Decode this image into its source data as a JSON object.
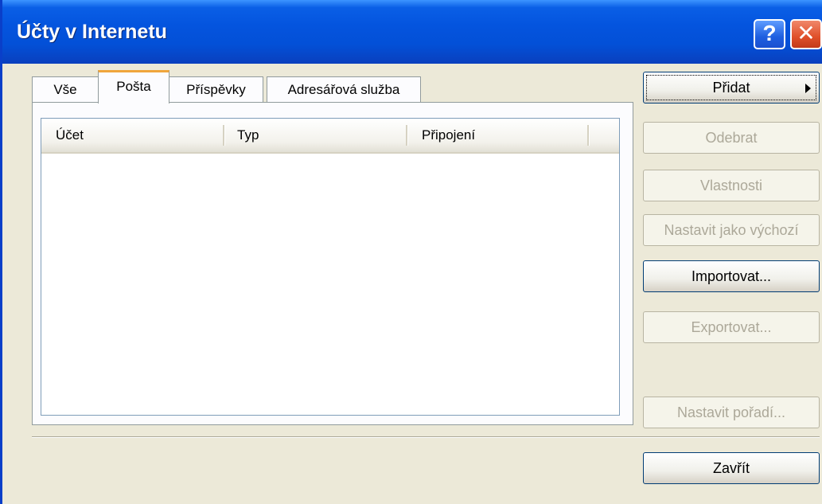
{
  "window": {
    "title": "Účty v Internetu",
    "help_glyph": "?",
    "close_glyph": "✕"
  },
  "tabs": [
    {
      "label": "Vše"
    },
    {
      "label": "Pošta",
      "active": true
    },
    {
      "label": "Příspěvky"
    },
    {
      "label": "Adresářová služba"
    }
  ],
  "list": {
    "columns": [
      "Účet",
      "Typ",
      "Připojení"
    ],
    "rows": []
  },
  "buttons": {
    "add": "Přidat",
    "remove": "Odebrat",
    "properties": "Vlastnosti",
    "set_default": "Nastavit jako výchozí",
    "import": "Importovat...",
    "export": "Exportovat...",
    "set_order": "Nastavit pořadí...",
    "close": "Zavřít"
  },
  "colors": {
    "titlebar": "#0454de",
    "face": "#ece9d8",
    "tab_highlight": "#f0a63c",
    "close_button": "#e0502a"
  }
}
